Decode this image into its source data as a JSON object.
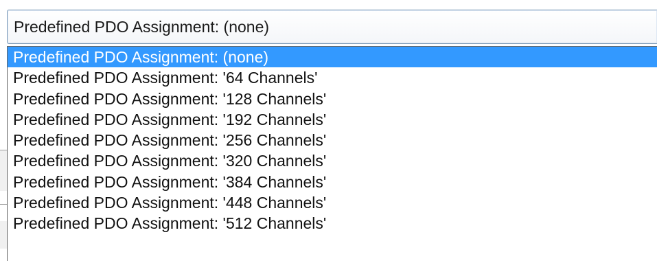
{
  "combo": {
    "value": "Predefined PDO Assignment: (none)"
  },
  "dropdown": {
    "selected_index": 0,
    "options": [
      "Predefined PDO Assignment: (none)",
      "Predefined PDO Assignment: '64 Channels'",
      "Predefined PDO Assignment: '128 Channels'",
      "Predefined PDO Assignment: '192 Channels'",
      "Predefined PDO Assignment: '256 Channels'",
      "Predefined PDO Assignment: '320 Channels'",
      "Predefined PDO Assignment: '384 Channels'",
      "Predefined PDO Assignment: '448 Channels'",
      "Predefined PDO Assignment: '512 Channels'"
    ]
  },
  "colors": {
    "selection": "#3399ff",
    "combo_border": "#7f9db9"
  }
}
